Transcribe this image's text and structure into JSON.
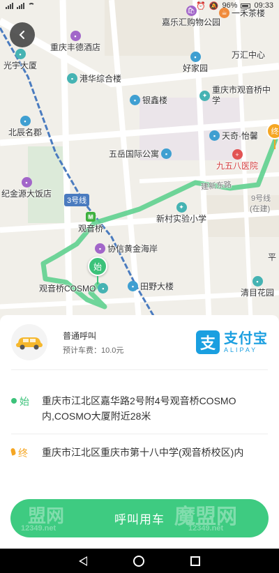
{
  "status_bar": {
    "battery": "96%",
    "time": "09:33"
  },
  "map": {
    "pois": [
      {
        "label": "嘉乐汇购物公园",
        "icon": "shopping-icon",
        "color": "purple"
      },
      {
        "label": "一禾茶楼",
        "icon": "restaurant-icon",
        "color": "orange"
      },
      {
        "label": "重庆丰德酒店",
        "icon": "hotel-icon",
        "color": "purple"
      },
      {
        "label": "光宇大厦",
        "icon": "building-icon",
        "color": "teal"
      },
      {
        "label": "万汇中心",
        "icon": "building-icon",
        "color": "teal"
      },
      {
        "label": "好家园",
        "icon": "residence-icon",
        "color": "blue"
      },
      {
        "label": "港华综合楼",
        "icon": "building-icon",
        "color": "teal"
      },
      {
        "label": "银鑫楼",
        "icon": "building-icon",
        "color": "blue"
      },
      {
        "label": "重庆市观音桥中学",
        "icon": "school-icon",
        "color": "teal"
      },
      {
        "label": "北辰名郡",
        "icon": "residence-icon",
        "color": "blue"
      },
      {
        "label": "天奇·怡馨",
        "icon": "residence-icon",
        "color": "blue"
      },
      {
        "label": "五岳国际公寓",
        "icon": "building-icon",
        "color": "blue"
      },
      {
        "label": "九五八医院",
        "icon": "hospital-icon",
        "color": "red"
      },
      {
        "label": "纪金源大饭店",
        "icon": "hotel-icon",
        "color": "purple"
      },
      {
        "label": "新村实验小学",
        "icon": "school-icon",
        "color": "teal"
      },
      {
        "label": "协信黄金海岸",
        "icon": "residence-icon",
        "color": "purple"
      },
      {
        "label": "观音桥COSMO",
        "icon": "building-icon",
        "color": "teal"
      },
      {
        "label": "田野大楼",
        "icon": "building-icon",
        "color": "blue"
      },
      {
        "label": "清目花园",
        "icon": "residence-icon",
        "color": "teal"
      }
    ],
    "metro_station": "观音桥",
    "line_tag": "3号线",
    "road_label": "建新东路",
    "line9_label": "9号线",
    "line9_note": "(在建)",
    "edge_label": "平",
    "start_marker": "始",
    "end_marker": "终"
  },
  "ride": {
    "type": "普通呼叫",
    "fee_label": "预计车费：10.0元"
  },
  "payment": {
    "name": "支付宝",
    "name_en": "ALIPAY",
    "logo_char": "支"
  },
  "route": {
    "start_tag": "始",
    "start_address": "重庆市江北区嘉华路2号附4号观音桥COSMO内,COSMO大厦附近28米",
    "end_tag": "终",
    "end_address": "重庆市江北区重庆市第十八中学(观音桥校区)内"
  },
  "action": {
    "call_label": "呼叫用车"
  },
  "watermark": {
    "text1": "盟网",
    "sub1": "12349.net",
    "text2": "魔盟网",
    "sub2": "12349.net"
  },
  "colors": {
    "accent": "#3ecb81",
    "start": "#3cc27a",
    "end": "#f5a623",
    "alipay": "#1a9fe0"
  }
}
